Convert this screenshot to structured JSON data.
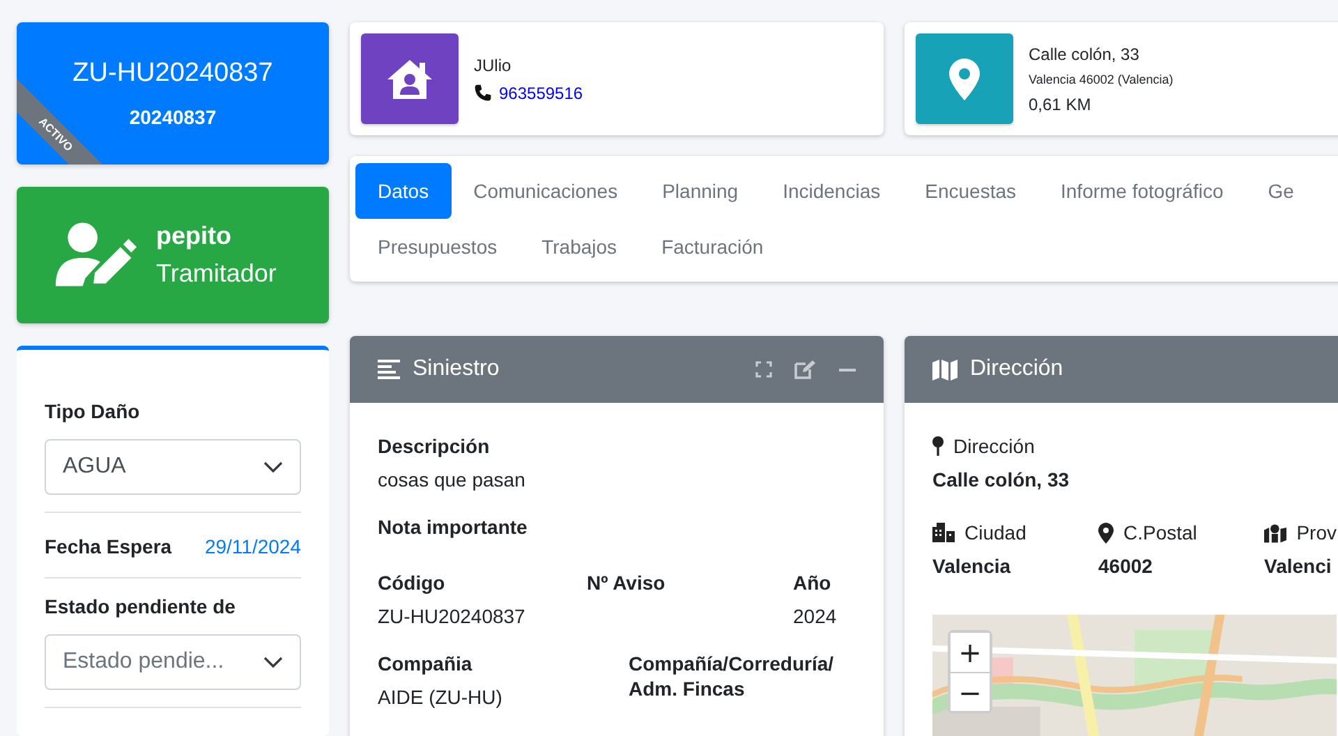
{
  "case_card": {
    "code": "ZU-HU20240837",
    "number": "20240837",
    "ribbon": "ACTIVO"
  },
  "user_card": {
    "name": "pepito",
    "role": "Tramitador"
  },
  "sidebar_fields": [
    {
      "kind": "select",
      "label": "Tipo Daño",
      "value": "AGUA"
    },
    {
      "kind": "date",
      "label": "Fecha Espera",
      "value": "29/11/2024"
    },
    {
      "kind": "select",
      "label": "Estado pendiente de",
      "placeholder": "Estado pendie..."
    }
  ],
  "contact_card": {
    "name": "JUlio",
    "phone": "963559516"
  },
  "address_card": {
    "street": "Calle colón, 33",
    "city_line": "Valencia 46002 (Valencia)",
    "distance": "0,61 KM"
  },
  "tabs": [
    {
      "label": "Datos",
      "selected": true
    },
    {
      "label": "Comunicaciones",
      "selected": false
    },
    {
      "label": "Planning",
      "selected": false
    },
    {
      "label": "Incidencias",
      "selected": false
    },
    {
      "label": "Encuestas",
      "selected": false
    },
    {
      "label": "Informe fotográfico",
      "selected": false
    },
    {
      "label": "Ge",
      "selected": false
    },
    {
      "label": "Presupuestos",
      "selected": false
    },
    {
      "label": "Trabajos",
      "selected": false
    },
    {
      "label": "Facturación",
      "selected": false
    }
  ],
  "siniestro_panel": {
    "title": "Siniestro",
    "rows": [
      [
        {
          "label": "Descripción",
          "value": "cosas que pasan"
        }
      ],
      [
        {
          "label": "Nota importante"
        }
      ],
      [
        {
          "label": "Código",
          "value": "ZU-HU20240837"
        },
        {
          "label": "Nº Aviso"
        },
        {
          "label": "Año",
          "value": "2024"
        }
      ],
      [
        {
          "label": "Compañia",
          "value": "AIDE (ZU-HU)"
        },
        {
          "label": "Compañía/Correduría/ Adm. Fincas"
        }
      ]
    ]
  },
  "direccion_panel": {
    "title": "Dirección",
    "address_label": "Dirección",
    "address": "Calle colón, 33",
    "fields": [
      {
        "kind": "city",
        "label": "Ciudad",
        "value": "Valencia"
      },
      {
        "kind": "pin",
        "label": "C.Postal",
        "value": "46002"
      },
      {
        "kind": "map",
        "label": "Prov",
        "value": "Valenci"
      }
    ],
    "map": {
      "kind": "picture",
      "zoom_in": "+",
      "zoom_out": "−"
    }
  }
}
